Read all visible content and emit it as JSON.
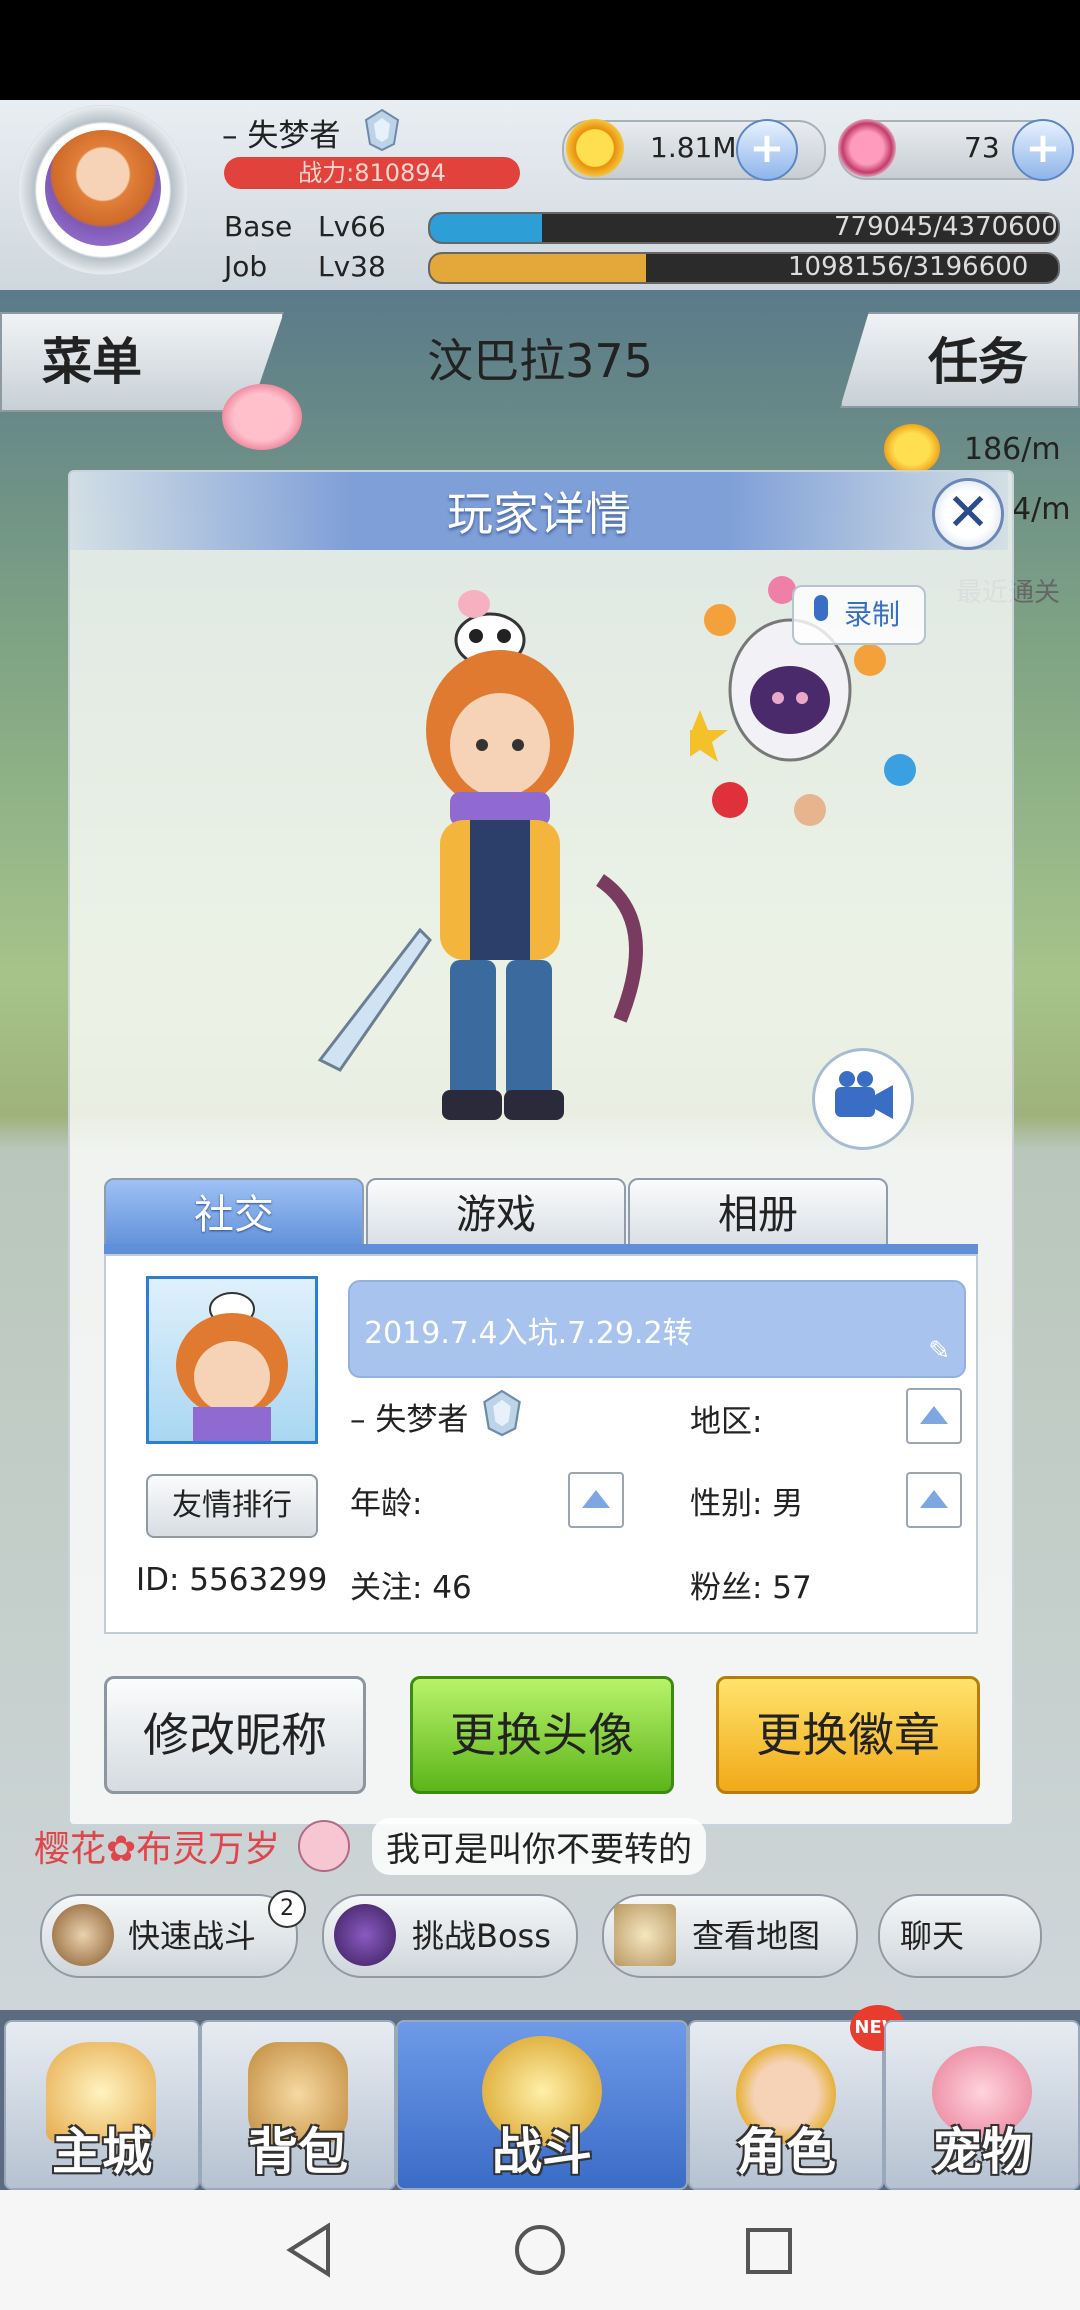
{
  "hud": {
    "player_name": "– 失梦者",
    "power": "战力:810894",
    "gold": "1.81M",
    "gems": "73",
    "base_label": "Base",
    "base_level": "Lv66",
    "base_exp": "779045/4370600",
    "base_progress": 0.178,
    "job_label": "Job",
    "job_level": "Lv38",
    "job_exp": "1098156/3196600",
    "job_progress": 0.344
  },
  "scene": {
    "menu_label": "菜单",
    "task_label": "任务",
    "map_name": "汶巴拉375",
    "rate_1": "186/m",
    "rate_2": "4/m",
    "recent_pass": "最近通关"
  },
  "modal": {
    "title": "玩家详情",
    "record_label": "录制",
    "tabs": [
      "社交",
      "游戏",
      "相册"
    ],
    "signature": "2019.7.4入坑.7.29.2转",
    "name": "– 失梦者",
    "region_label": "地区:",
    "age_label": "年龄:",
    "gender_label": "性别: 男",
    "rank_button": "友情排行",
    "id_label": "ID: 5563299",
    "follow_label": "关注: 46",
    "fans_label": "粉丝: 57",
    "btn_rename": "修改昵称",
    "btn_avatar": "更换头像",
    "btn_badge": "更换徽章"
  },
  "chat": {
    "sender": "樱花✿布灵万岁",
    "message": "我可是叫你不要转的"
  },
  "actions": {
    "quick_battle": "快速战斗",
    "quick_battle_count": "2",
    "boss": "挑战Boss",
    "map": "查看地图",
    "chat": "聊天"
  },
  "nav": {
    "items": [
      "主城",
      "背包",
      "战斗",
      "角色",
      "宠物"
    ],
    "new_badge": "NEW"
  },
  "colors": {
    "base_bar": "#2e9fd6",
    "job_bar": "#e2a839",
    "accent_blue": "#5f8fd8"
  }
}
